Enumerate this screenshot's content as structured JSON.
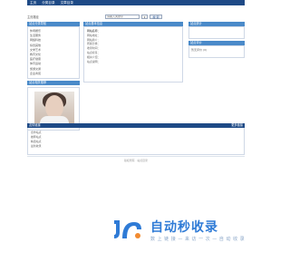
{
  "nav": {
    "items": [
      "主页",
      "分类目录",
      "文章目录"
    ]
  },
  "search": {
    "site_label": "主页路径",
    "input_value": "请输入关键字",
    "select_label": "▾",
    "button_label": "搜 索"
  },
  "left": {
    "title": "站点分类导航",
    "items": [
      "休闲娱乐",
      "生活服务",
      "网络科技",
      "综合其他",
      "文学艺术",
      "教育文化",
      "医疗健康",
      "体育运动",
      "旅游交通",
      "企业商贸"
    ],
    "bottom_title": "站点相关推荐"
  },
  "center": {
    "title": "站点基本信息",
    "lines": [
      "网站名称：",
      "网站地址：",
      "网站简介：",
      "所属分类：",
      "收录时间：",
      "站点标签：",
      "相关介绍：",
      "站点说明："
    ]
  },
  "right": {
    "title1": "站点统计",
    "title2": "站点评价",
    "text2": "暂无评价 (0)"
  },
  "links": {
    "title": "友情链接",
    "more": "更多链接",
    "lines": [
      "合作站点",
      "推荐站点",
      "精选站点",
      "最新收录"
    ]
  },
  "footer": {
    "text": "版权所有 · 站点目录"
  },
  "watermark": {
    "title": "自动秒收录",
    "subtitle": "数 上 链 接 — 来 访 一 次 — 自 动 收 录"
  },
  "colors": {
    "nav": "#1e4a86",
    "accent": "#4a8ac9",
    "brand": "#2f7bd6"
  }
}
